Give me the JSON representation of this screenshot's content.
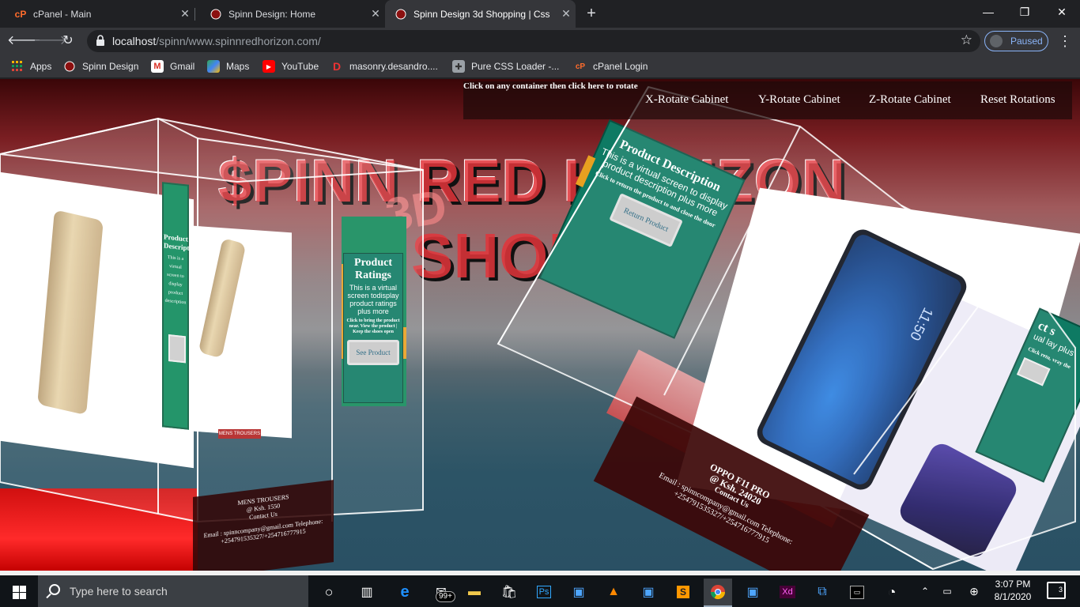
{
  "browser": {
    "tabs": [
      {
        "title": "cPanel - Main",
        "active": false
      },
      {
        "title": "Spinn Design: Home",
        "active": false
      },
      {
        "title": "Spinn Design 3d Shopping | Css",
        "active": true
      }
    ],
    "url": {
      "host": "localhost",
      "path": "/spinn/www.spinnredhorizon.com/"
    },
    "profile_status": "Paused",
    "bookmarks": [
      {
        "label": "Apps",
        "icon": "apps-grid-icon"
      },
      {
        "label": "Spinn Design",
        "icon": "spinn-design-icon"
      },
      {
        "label": "Gmail",
        "icon": "gmail-icon"
      },
      {
        "label": "Maps",
        "icon": "maps-icon"
      },
      {
        "label": "YouTube",
        "icon": "youtube-icon"
      },
      {
        "label": "masonry.desandro....",
        "icon": "masonry-icon"
      },
      {
        "label": "Pure CSS Loader -...",
        "icon": "puzzle-icon"
      },
      {
        "label": "cPanel Login",
        "icon": "cpanel-icon"
      }
    ]
  },
  "page": {
    "heading_line1": "$PINN RED HORIZON",
    "heading_3d": "3D",
    "heading_line2": "SHOP",
    "control_hint": "Click on any container then click here to rotate",
    "controls": [
      "X-Rotate Cabinet",
      "Y-Rotate Cabinet",
      "Z-Rotate Cabinet",
      "Reset Rotations"
    ],
    "cabinet1": {
      "side_panel": {
        "title": "Product Description",
        "text": "This is a virtual screen to display product description"
      },
      "ratings_panel": {
        "title": "Product Ratings",
        "text": "This is a virtual screen todisplay product ratings plus more",
        "small": "Click to bring the product near. View the product | Keep the shoes open",
        "button": "See Product"
      },
      "base_text": [
        "MENS TROUSERS",
        "@ Ksh. 1550",
        "Contact Us",
        "Email : spinncompany@gmail.com Telephone:",
        "+254791535327/+254716777915"
      ]
    },
    "cabinet2": {
      "desc_panel": {
        "title": "Product Description",
        "text": "This is a virtual screen to display product description plus more",
        "small": "Click to return the product to and close the door",
        "button": "Return Product"
      },
      "right_panel": {
        "title": "ct s",
        "text": "ual lay plus",
        "small": "Click retu, vray the"
      },
      "phone_time": "11:50",
      "base_text": [
        "OPPO F11 PRO",
        "@ Ksh. 24020",
        "Contact Us",
        "Email : spinncompany@gmail.com Telephone:",
        "+254791535327/+254716777915"
      ]
    }
  },
  "taskbar": {
    "search_placeholder": "Type here to search",
    "mail_badge": "99+",
    "time": "3:07 PM",
    "date": "8/1/2020",
    "notification_count": "3"
  },
  "colors": {
    "accent_red": "#e2343a",
    "panel_green": "#0e7a63",
    "chrome_dark": "#202124",
    "chrome_toolbar": "#35363a"
  }
}
